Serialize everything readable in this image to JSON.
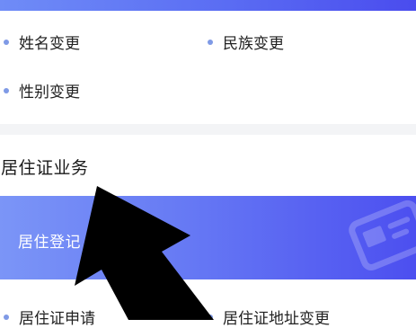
{
  "marital_section": {
    "items": [
      {
        "label": "姓名变更"
      },
      {
        "label": "民族变更"
      },
      {
        "label": "性别变更"
      }
    ]
  },
  "residence_section": {
    "title": "居住证业务",
    "banner_label": "居住登记",
    "banner_icon": "id-card-icon",
    "items": [
      {
        "label": "居住证申请"
      },
      {
        "label": "居住证地址变更"
      }
    ]
  },
  "colors": {
    "accent_gradient_start": "#7b95f7",
    "accent_gradient_end": "#4c4ff0",
    "bullet": "#7f9ae6"
  }
}
